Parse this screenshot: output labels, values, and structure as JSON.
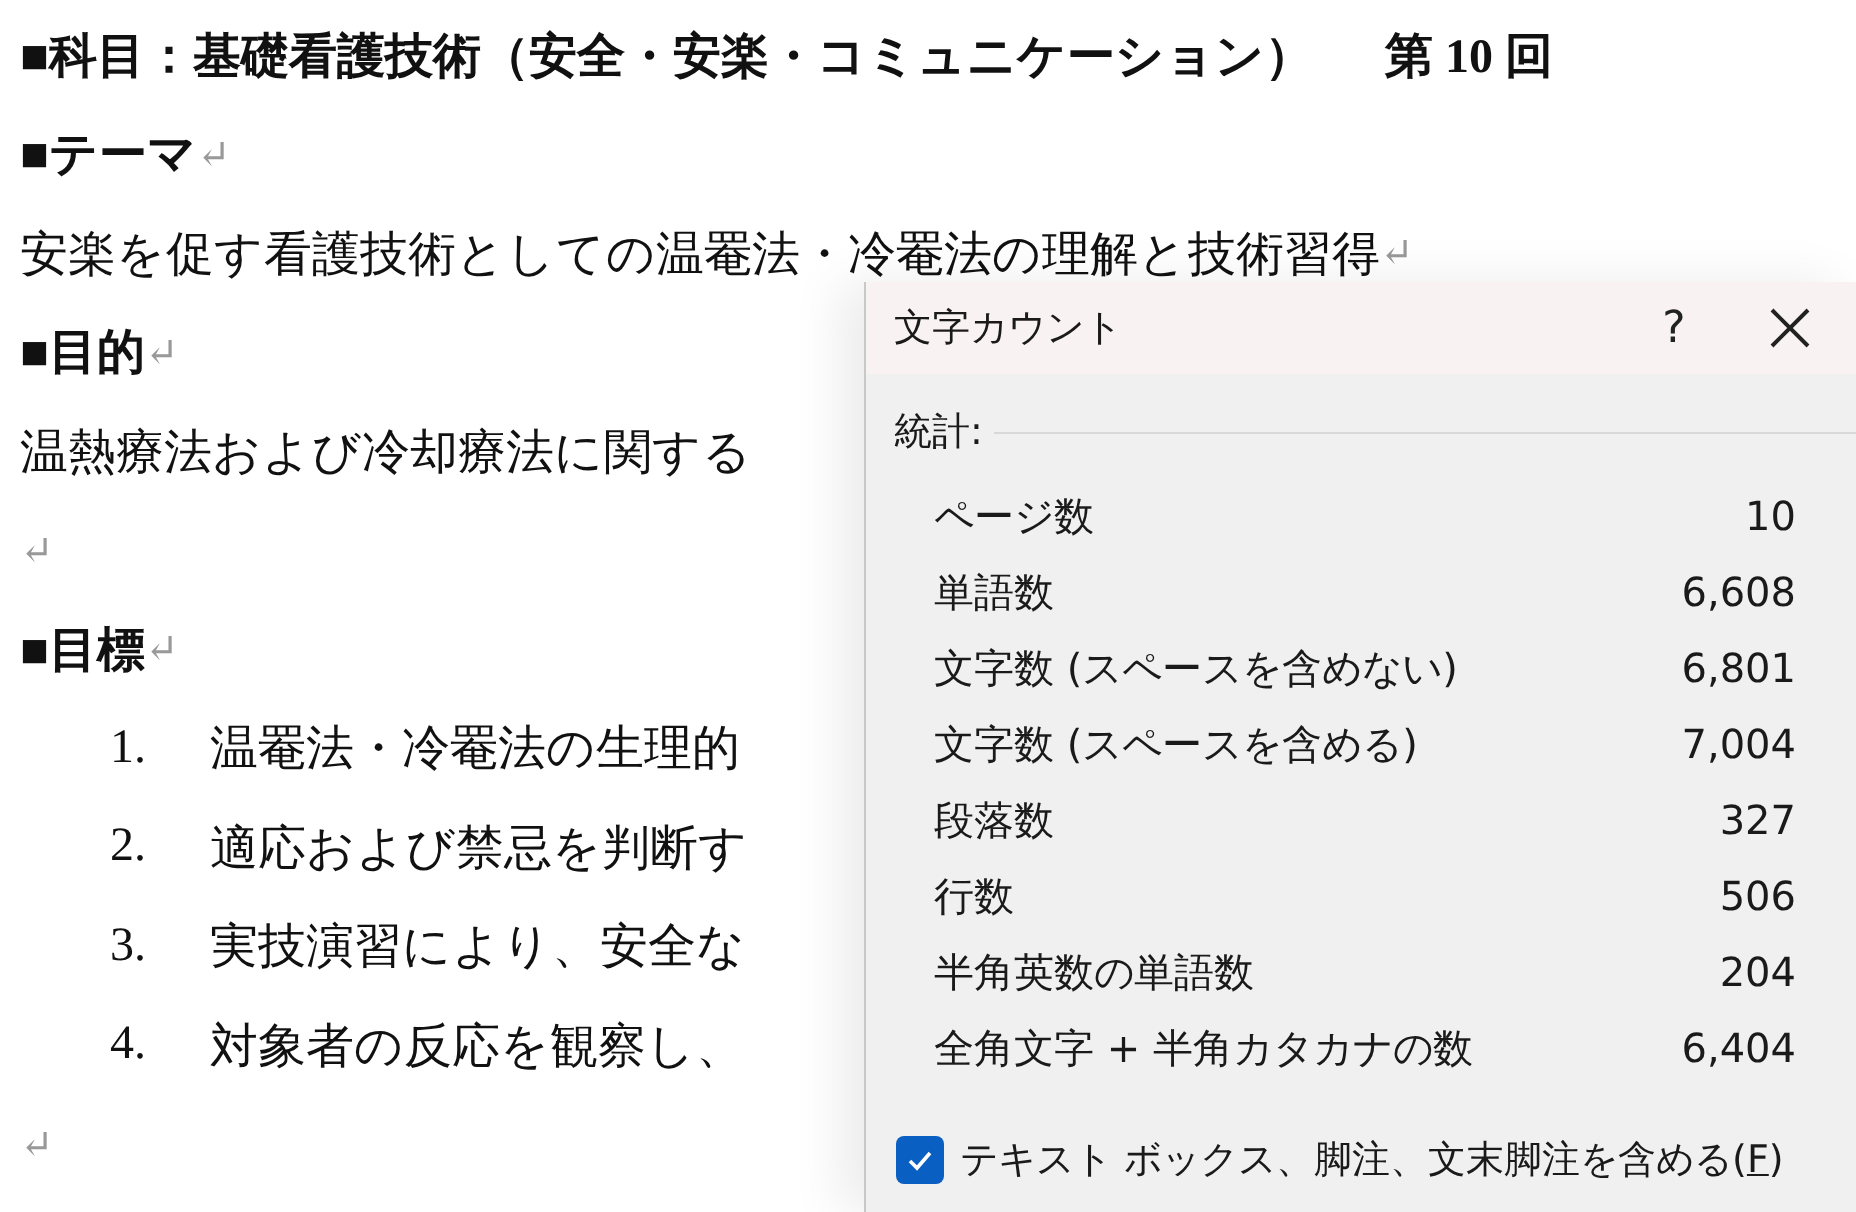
{
  "document": {
    "title": {
      "text": "■科目：基礎看護技術（安全・安楽・コミュニケーション）",
      "session": "第 10 回"
    },
    "paragraphs": [
      {
        "kind": "heading",
        "text": "■テーマ",
        "mark": "↵"
      },
      {
        "kind": "body",
        "text": "安楽を促す看護技術としての温罨法・冷罨法の理解と技術習得",
        "mark": "↵"
      },
      {
        "kind": "heading",
        "text": "■目的",
        "mark": "↵"
      },
      {
        "kind": "body",
        "text": "温熱療法および冷却療法に関する"
      },
      {
        "kind": "empty",
        "mark": "↵"
      },
      {
        "kind": "heading",
        "text": "■目標",
        "mark": "↵"
      },
      {
        "kind": "item",
        "number": "1.",
        "text": "温罨法・冷罨法の生理的"
      },
      {
        "kind": "item",
        "number": "2.",
        "text": "適応および禁忌を判断す"
      },
      {
        "kind": "item",
        "number": "3.",
        "text": "実技演習により、安全な"
      },
      {
        "kind": "item",
        "number": "4.",
        "text": "対象者の反応を観察し、"
      },
      {
        "kind": "empty",
        "mark": "↵"
      }
    ]
  },
  "dialog": {
    "title": "文字カウント",
    "help": "?",
    "section": "統計:",
    "stats": [
      {
        "label": "ページ数",
        "value": "10"
      },
      {
        "label": "単語数",
        "value": "6,608"
      },
      {
        "label": "文字数 (スペースを含めない)",
        "value": "6,801"
      },
      {
        "label": "文字数 (スペースを含める)",
        "value": "7,004"
      },
      {
        "label": "段落数",
        "value": "327"
      },
      {
        "label": "行数",
        "value": "506"
      },
      {
        "label": "半角英数の単語数",
        "value": "204"
      },
      {
        "label": "全角文字 + 半角カタカナの数",
        "value": "6,404"
      }
    ],
    "option": {
      "label": "テキスト ボックス、脚注、文末脚注を含める(",
      "accesskey": "F",
      "label_end": ")",
      "checked": true
    }
  }
}
